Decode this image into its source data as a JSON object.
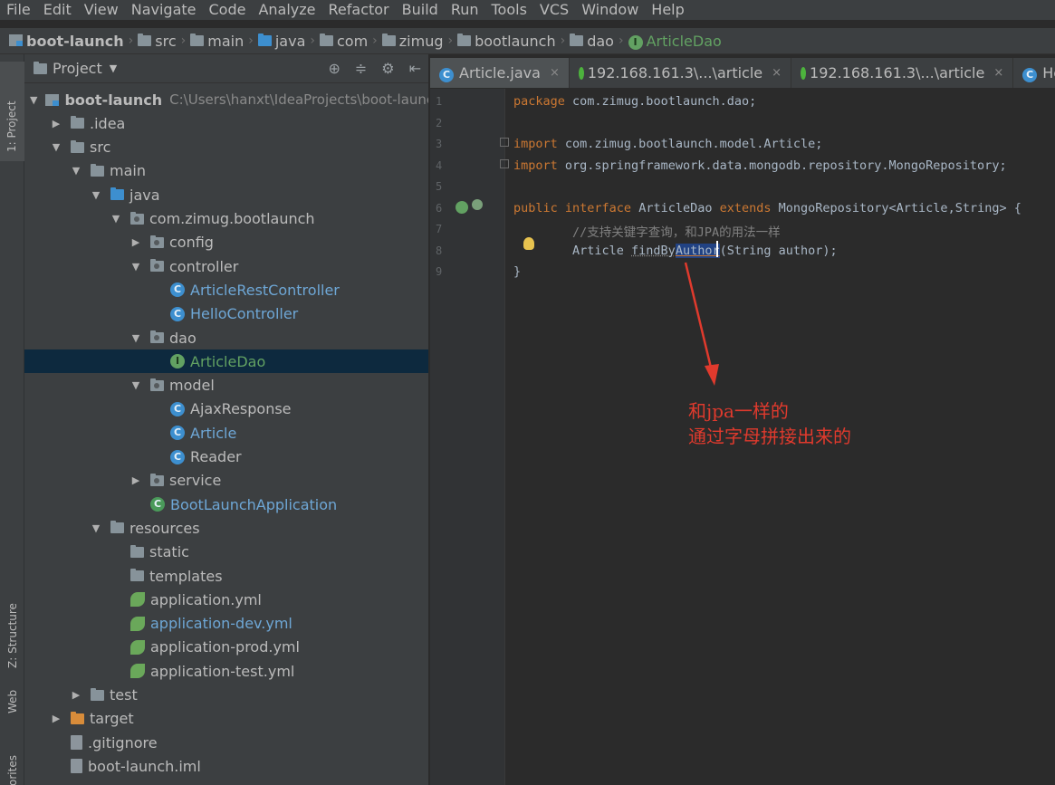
{
  "menu": [
    "File",
    "Edit",
    "View",
    "Navigate",
    "Code",
    "Analyze",
    "Refactor",
    "Build",
    "Run",
    "Tools",
    "VCS",
    "Window",
    "Help"
  ],
  "breadcrumb": [
    "boot-launch",
    "src",
    "main",
    "java",
    "com",
    "zimug",
    "bootlaunch",
    "dao",
    "ArticleDao"
  ],
  "toolstrip": {
    "project": "1: Project",
    "structure": "Z: Structure",
    "web": "Web",
    "favorites": "orites"
  },
  "project_panel": {
    "title": "Project",
    "tree": [
      {
        "label": "boot-launch",
        "path": "C:\\Users\\hanxt\\IdeaProjects\\boot-launch",
        "arrow": "▼",
        "icon": "module",
        "depth": 0,
        "bold": true
      },
      {
        "label": ".idea",
        "arrow": "▶",
        "icon": "folder",
        "depth": 1
      },
      {
        "label": "src",
        "arrow": "▼",
        "icon": "folder",
        "depth": 1
      },
      {
        "label": "main",
        "arrow": "▼",
        "icon": "folder",
        "depth": 2
      },
      {
        "label": "java",
        "arrow": "▼",
        "icon": "folder-blue",
        "depth": 3
      },
      {
        "label": "com.zimug.bootlaunch",
        "arrow": "▼",
        "icon": "package",
        "depth": 4
      },
      {
        "label": "config",
        "arrow": "▶",
        "icon": "package",
        "depth": 5
      },
      {
        "label": "controller",
        "arrow": "▼",
        "icon": "package",
        "depth": 5
      },
      {
        "label": "ArticleRestController",
        "arrow": "",
        "icon": "class",
        "depth": 6,
        "color": "blue"
      },
      {
        "label": "HelloController",
        "arrow": "",
        "icon": "class",
        "depth": 6,
        "color": "blue"
      },
      {
        "label": "dao",
        "arrow": "▼",
        "icon": "package",
        "depth": 5
      },
      {
        "label": "ArticleDao",
        "arrow": "",
        "icon": "interface",
        "depth": 6,
        "color": "green",
        "selected": true
      },
      {
        "label": "model",
        "arrow": "▼",
        "icon": "package",
        "depth": 5
      },
      {
        "label": "AjaxResponse",
        "arrow": "",
        "icon": "class",
        "depth": 6
      },
      {
        "label": "Article",
        "arrow": "",
        "icon": "class",
        "depth": 6,
        "color": "blue"
      },
      {
        "label": "Reader",
        "arrow": "",
        "icon": "class",
        "depth": 6
      },
      {
        "label": "service",
        "arrow": "▶",
        "icon": "package",
        "depth": 5
      },
      {
        "label": "BootLaunchApplication",
        "arrow": "",
        "icon": "spring-class",
        "depth": 5,
        "color": "blue"
      },
      {
        "label": "resources",
        "arrow": "▼",
        "icon": "folder-res",
        "depth": 3
      },
      {
        "label": "static",
        "arrow": "",
        "icon": "folder",
        "depth": 4
      },
      {
        "label": "templates",
        "arrow": "",
        "icon": "folder",
        "depth": 4
      },
      {
        "label": "application.yml",
        "arrow": "",
        "icon": "spring",
        "depth": 4
      },
      {
        "label": "application-dev.yml",
        "arrow": "",
        "icon": "spring",
        "depth": 4,
        "color": "blue"
      },
      {
        "label": "application-prod.yml",
        "arrow": "",
        "icon": "spring",
        "depth": 4
      },
      {
        "label": "application-test.yml",
        "arrow": "",
        "icon": "spring",
        "depth": 4
      },
      {
        "label": "test",
        "arrow": "▶",
        "icon": "folder",
        "depth": 2
      },
      {
        "label": "target",
        "arrow": "▶",
        "icon": "folder-orange",
        "depth": 1
      },
      {
        "label": ".gitignore",
        "arrow": "",
        "icon": "file",
        "depth": 1
      },
      {
        "label": "boot-launch.iml",
        "arrow": "",
        "icon": "file",
        "depth": 1
      }
    ]
  },
  "tabs": [
    {
      "label": "Article.java",
      "icon": "class",
      "active": true
    },
    {
      "label": "192.168.161.3\\...\\article",
      "icon": "mongo"
    },
    {
      "label": "192.168.161.3\\...\\article",
      "icon": "mongo"
    },
    {
      "label": "HelloCo",
      "icon": "class"
    }
  ],
  "code": {
    "line_numbers": [
      "1",
      "2",
      "3",
      "4",
      "5",
      "6",
      "7",
      "8",
      "9"
    ],
    "l1_kw": "package",
    "l1_rest": " com.zimug.bootlaunch.dao;",
    "l3_kw": "import",
    "l3_rest": " com.zimug.bootlaunch.model.Article;",
    "l4_kw": "import",
    "l4_rest": " org.springframework.data.mongodb.repository.MongoRepository;",
    "l6_kw1": "public",
    "l6_kw2": " interface",
    "l6_mid": " ArticleDao",
    "l6_kw3": " extends",
    "l6_rest": " MongoRepository<Article,String> {",
    "l7_comment": "        //支持关键字查询，和JPA的用法一样",
    "l8_pre": "        Article ",
    "l8_find": "findBy",
    "l8_author": "Author",
    "l8_post": "(String author);",
    "l9": "}"
  },
  "annotation": {
    "line1": "和jpa一样的",
    "line2": "通过字母拼接出来的"
  },
  "colors": {
    "annotation": "#e03a2d",
    "selection": "#214283",
    "keyword": "#cc7832"
  }
}
